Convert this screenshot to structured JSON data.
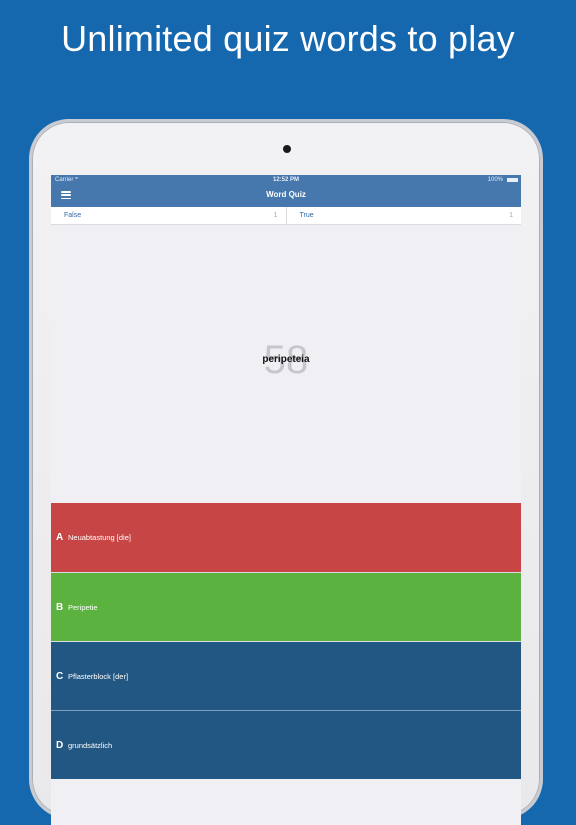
{
  "headline": "Unlimited quiz words to play",
  "status_bar": {
    "carrier": "Carrier",
    "wifi_icon": "wifi-icon",
    "time": "12:52 PM",
    "battery": "100%"
  },
  "nav": {
    "menu_icon": "hamburger-menu-icon",
    "title": "Word Quiz"
  },
  "scores": {
    "false_label": "False",
    "false_count": "1",
    "true_label": "True",
    "true_count": "1"
  },
  "question": {
    "timer": "58",
    "word": "peripeteia"
  },
  "answers": [
    {
      "letter": "A",
      "text": "Neuabtastung [die]",
      "color": "#c84545"
    },
    {
      "letter": "B",
      "text": "Peripetie",
      "color": "#5bb23f"
    },
    {
      "letter": "C",
      "text": "Pflasterblock [der]",
      "color": "#235783"
    },
    {
      "letter": "D",
      "text": "grundsätzlich",
      "color": "#235783"
    }
  ],
  "colors": {
    "background": "#1567ae",
    "nav_bar": "#4677ad",
    "wrong": "#c84545",
    "correct": "#5bb23f",
    "neutral": "#235783"
  }
}
